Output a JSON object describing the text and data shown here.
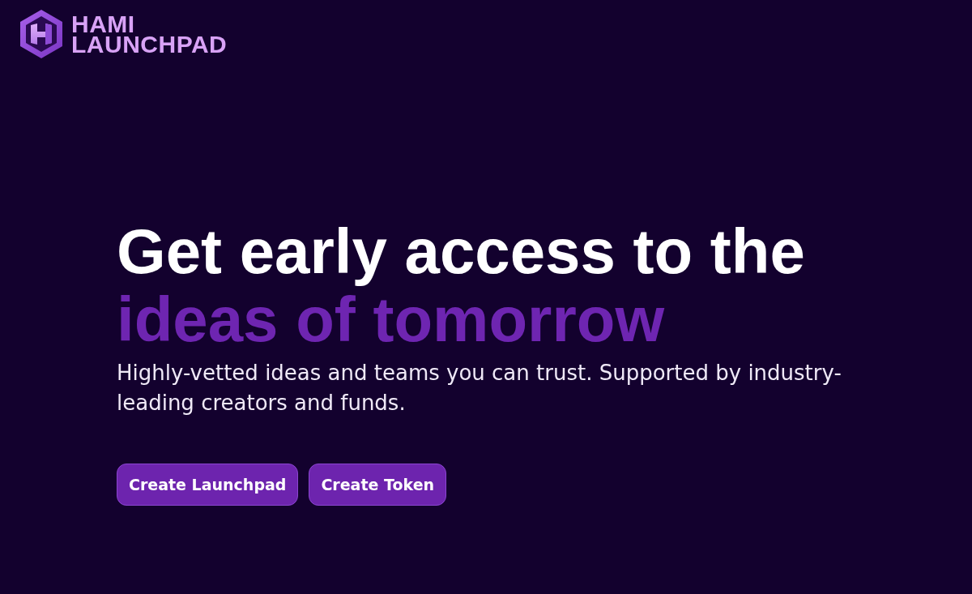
{
  "brand": {
    "name": "HAMI LAUNCHPAD"
  },
  "hero": {
    "headline": "Get early access to the",
    "headline_highlight": "ideas of tomorrow",
    "subtitle": "Highly-vetted ideas and teams you can trust. Supported by industry-leading creators and funds."
  },
  "buttons": [
    {
      "label": "Create Launchpad"
    },
    {
      "label": "Create Token"
    }
  ]
}
